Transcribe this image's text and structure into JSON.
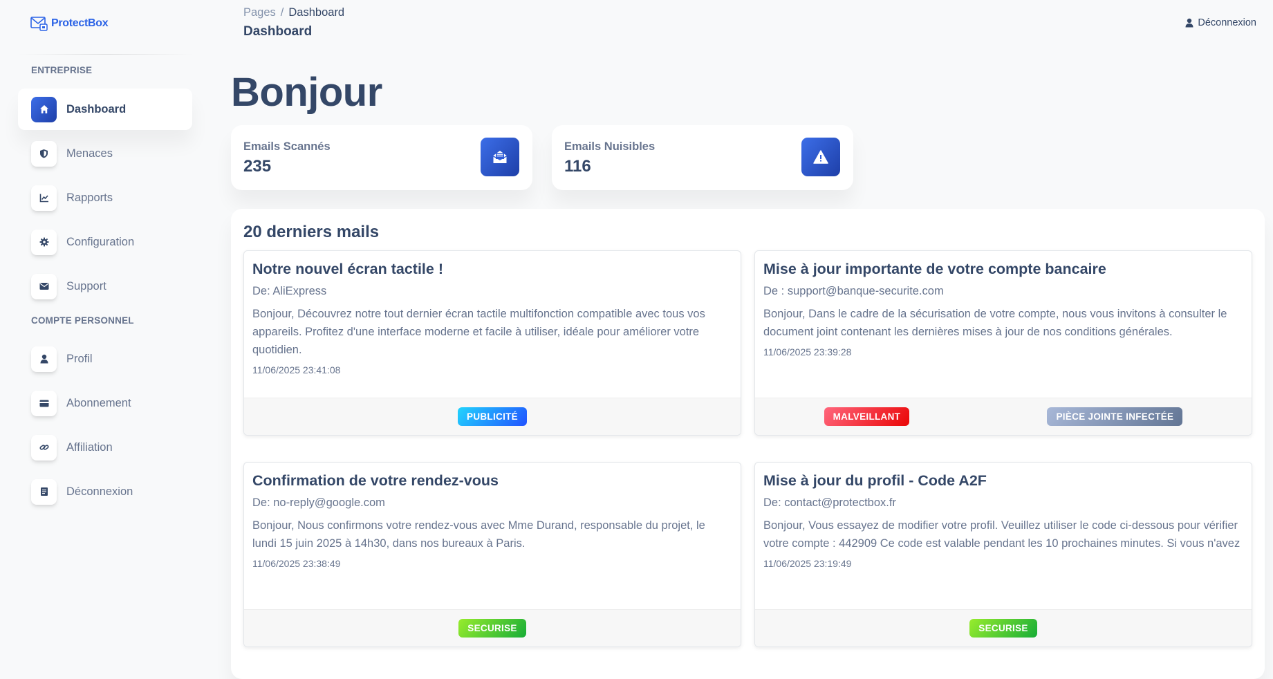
{
  "brand": {
    "name": "ProtectBox"
  },
  "header": {
    "breadcrumb_root": "Pages",
    "breadcrumb_sep": "/",
    "breadcrumb_current": "Dashboard",
    "page_title": "Dashboard",
    "logout_label": "Déconnexion"
  },
  "sidebar": {
    "section_company": "ENTREPRISE",
    "section_personal": "COMPTE PERSONNEL",
    "items": [
      {
        "label": "Dashboard",
        "icon": "home-icon",
        "active": true
      },
      {
        "label": "Menaces",
        "icon": "shield-icon"
      },
      {
        "label": "Rapports",
        "icon": "chart-line-icon"
      },
      {
        "label": "Configuration",
        "icon": "gear-icon"
      },
      {
        "label": "Support",
        "icon": "envelope-icon"
      },
      {
        "label": "Profil",
        "icon": "user-icon"
      },
      {
        "label": "Abonnement",
        "icon": "credit-card-icon"
      },
      {
        "label": "Affiliation",
        "icon": "link-icon"
      },
      {
        "label": "Déconnexion",
        "icon": "document-icon"
      }
    ]
  },
  "main": {
    "greeting": "Bonjour",
    "stats": [
      {
        "label": "Emails Scannés",
        "value": "235",
        "icon": "envelope-open-icon"
      },
      {
        "label": "Emails Nuisibles",
        "value": "116",
        "icon": "warning-icon"
      }
    ],
    "mails_title": "20 derniers mails",
    "mails": [
      {
        "subject": "Notre nouvel écran tactile !",
        "from": "De: AliExpress",
        "preview": "Bonjour, Découvrez notre tout dernier écran tactile multifonction compatible avec tous vos appareils. Profitez d'une interface moderne et facile à utiliser, idéale pour améliorer votre quotidien.",
        "date": "11/06/2025 23:41:08",
        "badges": [
          {
            "label": "PUBLICITÉ",
            "type": "info"
          }
        ]
      },
      {
        "subject": "Mise à jour importante de votre compte bancaire",
        "from": "De : support@banque-securite.com",
        "preview": "Bonjour, Dans le cadre de la sécurisation de votre compte, nous vous invitons à consulter le document joint contenant les dernières mises à jour de nos conditions générales.",
        "date": "11/06/2025 23:39:28",
        "badges": [
          {
            "label": "MALVEILLANT",
            "type": "danger"
          },
          {
            "label": "PIÈCE JOINTE INFECTÉE",
            "type": "secondary"
          }
        ]
      },
      {
        "subject": "Confirmation de votre rendez-vous",
        "from": "De: no-reply@google.com",
        "preview": "Bonjour, Nous confirmons votre rendez-vous avec Mme Durand, responsable du projet, le lundi 15 juin 2025 à 14h30, dans nos bureaux à Paris.",
        "date": "11/06/2025 23:38:49",
        "badges": [
          {
            "label": "SECURISE",
            "type": "success"
          }
        ]
      },
      {
        "subject": "Mise à jour du profil - Code A2F",
        "from": "De: contact@protectbox.fr",
        "preview": "Bonjour, Vous essayez de modifier votre profil. Veuillez utiliser le code ci-dessous pour vérifier votre compte : 442909 Ce code est valable pendant les 10 prochaines minutes. Si vous n'avez",
        "date": "11/06/2025 23:19:49",
        "badges": [
          {
            "label": "SECURISE",
            "type": "success"
          }
        ]
      }
    ]
  },
  "colors": {
    "accent": "#2b63e6",
    "text": "#344767",
    "muted": "#67748e",
    "background": "#f8f9fa"
  }
}
